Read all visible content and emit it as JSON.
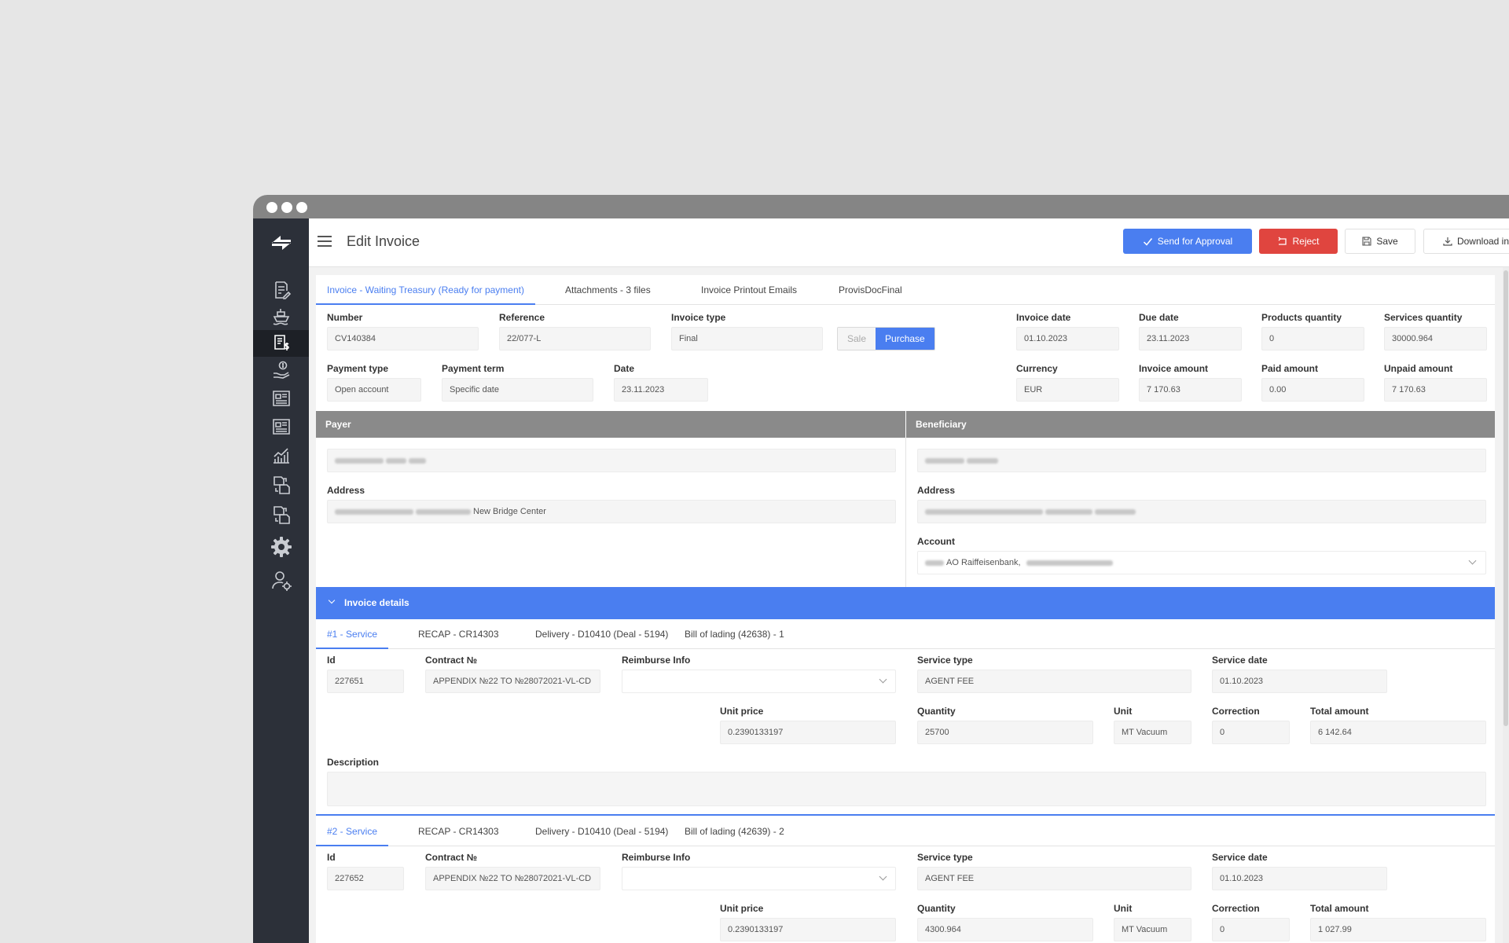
{
  "app": {
    "page_title": "Edit Invoice",
    "actions": {
      "send_for_approval": "Send for Approval",
      "reject": "Reject",
      "save": "Save",
      "download": "Download invoice"
    },
    "colors": {
      "primary": "#4a7ef0",
      "danger": "#e0453f",
      "sidebar": "#2c3039",
      "section_header": "#8a8a8a"
    }
  },
  "sidebar": {
    "items": [
      {
        "icon": "edit-document-icon"
      },
      {
        "icon": "ship-icon"
      },
      {
        "icon": "invoice-dollar-icon",
        "active": true
      },
      {
        "icon": "money-hand-icon"
      },
      {
        "icon": "newspaper-icon"
      },
      {
        "icon": "newspaper-icon"
      },
      {
        "icon": "bar-chart-icon"
      },
      {
        "icon": "documents-exchange-icon"
      },
      {
        "icon": "documents-exchange-icon"
      },
      {
        "icon": "gear-icon"
      },
      {
        "icon": "user-settings-icon"
      }
    ]
  },
  "tabs": [
    {
      "label": "Invoice - Waiting Treasury (Ready for payment)",
      "active": true
    },
    {
      "label": "Attachments - 3 files"
    },
    {
      "label": "Invoice Printout Emails"
    },
    {
      "label": "ProvisDocFinal"
    }
  ],
  "invoice": {
    "number": {
      "label": "Number",
      "value": "CV140384"
    },
    "reference": {
      "label": "Reference",
      "value": "22/077-L"
    },
    "invoice_type": {
      "label": "Invoice type",
      "value": "Final"
    },
    "toggle": {
      "sale": "Sale",
      "purchase": "Purchase",
      "selected": "Purchase"
    },
    "invoice_date": {
      "label": "Invoice date",
      "value": "01.10.2023"
    },
    "due_date": {
      "label": "Due date",
      "value": "23.11.2023"
    },
    "products_quantity": {
      "label": "Products quantity",
      "value": "0"
    },
    "services_quantity": {
      "label": "Services quantity",
      "value": "30000.964"
    },
    "payment_type": {
      "label": "Payment type",
      "value": "Open account"
    },
    "payment_term": {
      "label": "Payment term",
      "value": "Specific date"
    },
    "date": {
      "label": "Date",
      "value": "23.11.2023"
    },
    "currency": {
      "label": "Currency",
      "value": "EUR"
    },
    "invoice_amount": {
      "label": "Invoice amount",
      "value": "7 170.63"
    },
    "paid_amount": {
      "label": "Paid amount",
      "value": "0.00"
    },
    "unpaid_amount": {
      "label": "Unpaid amount",
      "value": "7 170.63"
    }
  },
  "payer": {
    "header": "Payer",
    "address_label": "Address",
    "address_visible": "New Bridge Center"
  },
  "beneficiary": {
    "header": "Beneficiary",
    "address_label": "Address",
    "account_label": "Account",
    "account_visible": "AO Raiffeisenbank,"
  },
  "details": {
    "header": "Invoice details",
    "items": [
      {
        "tabs": [
          "#1 - Service",
          "RECAP - CR14303",
          "Delivery - D10410 (Deal - 5194)",
          "Bill of lading (42638) - 1"
        ],
        "labels": {
          "id": "Id",
          "contract": "Contract №",
          "reimburse": "Reimburse Info",
          "service_type": "Service type",
          "service_date": "Service date",
          "unit_price": "Unit price",
          "quantity": "Quantity",
          "unit": "Unit",
          "correction": "Correction",
          "total_amount": "Total amount",
          "description": "Description"
        },
        "id": "227651",
        "contract": "APPENDIX №22 TO  №28072021-VL-CD",
        "reimburse": "",
        "service_type": "AGENT FEE",
        "service_date": "01.10.2023",
        "unit_price": "0.2390133197",
        "quantity": "25700",
        "unit": "MT Vacuum",
        "correction": "0",
        "total_amount": "6 142.64",
        "description": ""
      },
      {
        "tabs": [
          "#2 - Service",
          "RECAP - CR14303",
          "Delivery - D10410 (Deal - 5194)",
          "Bill of lading (42639) - 2"
        ],
        "labels": {
          "id": "Id",
          "contract": "Contract №",
          "reimburse": "Reimburse Info",
          "service_type": "Service type",
          "service_date": "Service date",
          "unit_price": "Unit price",
          "quantity": "Quantity",
          "unit": "Unit",
          "correction": "Correction",
          "total_amount": "Total amount"
        },
        "id": "227652",
        "contract": "APPENDIX №22 TO  №28072021-VL-CD",
        "reimburse": "",
        "service_type": "AGENT FEE",
        "service_date": "01.10.2023",
        "unit_price": "0.2390133197",
        "quantity": "4300.964",
        "unit": "MT Vacuum",
        "correction": "0",
        "total_amount": "1 027.99"
      }
    ]
  }
}
